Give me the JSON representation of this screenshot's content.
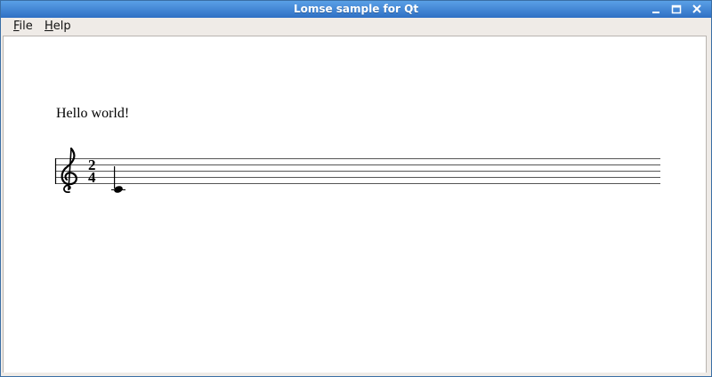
{
  "window": {
    "title": "Lomse sample for Qt",
    "controls": {
      "minimize_icon": "minimize-icon",
      "maximize_icon": "maximize-icon",
      "close_icon": "close-icon"
    }
  },
  "menubar": {
    "items": [
      {
        "label": "File",
        "mnemonic": "F",
        "rest": "ile"
      },
      {
        "label": "Help",
        "mnemonic": "H",
        "rest": "elp"
      }
    ]
  },
  "document": {
    "paragraph": "Hello world!",
    "score": {
      "clef": "G",
      "time_signature": {
        "numerator": "2",
        "denominator": "4"
      },
      "notes": [
        {
          "pitch": "C4",
          "duration": "quarter"
        }
      ],
      "staff_lines": 5
    }
  },
  "colors": {
    "titlebar_top": "#5aa0e6",
    "titlebar_bottom": "#2f6fc4",
    "chrome": "#efebe7",
    "canvas": "#ffffff"
  }
}
